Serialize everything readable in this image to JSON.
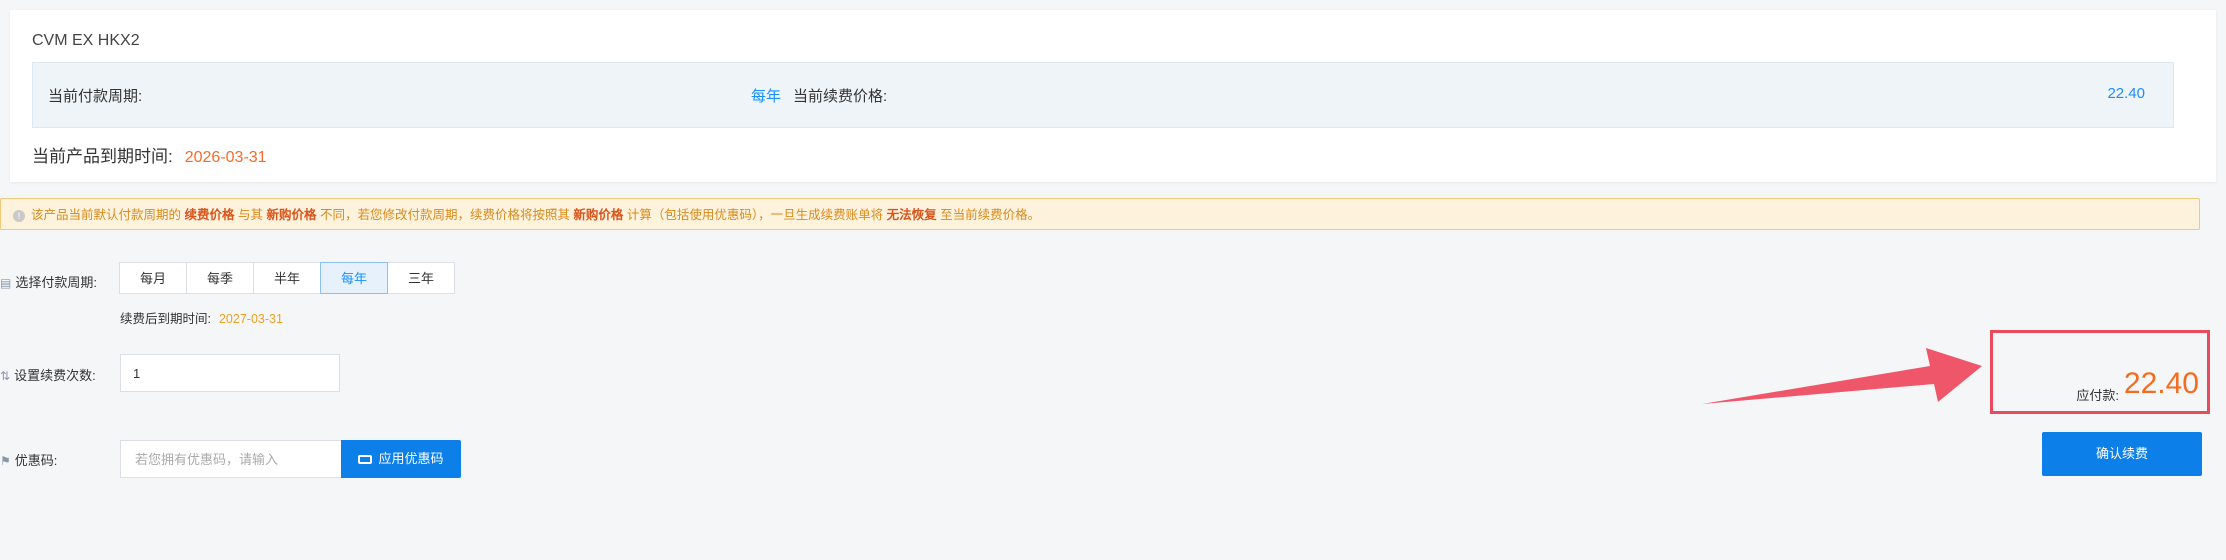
{
  "product": {
    "name": "CVM EX HKX2",
    "current_period_label": "当前付款周期:",
    "current_period_value": "每年",
    "current_price_label": "当前续费价格:",
    "current_price_value": "22.40",
    "expire_label": "当前产品到期时间:",
    "expire_value": "2026-03-31"
  },
  "notice": {
    "t1": "该产品当前默认付款周期的 ",
    "b1": "续费价格",
    "t2": " 与其 ",
    "b2": "新购价格",
    "t3": " 不同，若您修改付款周期，续费价格将按照其 ",
    "b3": "新购价格",
    "t4": " 计算（包括使用优惠码），一旦生成续费账单将 ",
    "b4": "无法恢复",
    "t5": " 至当前续费价格。"
  },
  "period": {
    "label": "选择付款周期:",
    "options": [
      "每月",
      "每季",
      "半年",
      "每年",
      "三年"
    ],
    "selected": "每年",
    "after_label": "续费后到期时间:",
    "after_value": "2027-03-31"
  },
  "renew_count": {
    "label": "设置续费次数:",
    "value": "1"
  },
  "coupon": {
    "label": "优惠码:",
    "placeholder": "若您拥有优惠码，请输入",
    "button": "应用优惠码"
  },
  "payment": {
    "label": "应付款:",
    "amount": "22.40",
    "confirm": "确认续费"
  },
  "colors": {
    "accent": "#0d7fe8",
    "price": "#f56c1f",
    "highlight_box": "#e94b5c",
    "arrow": "#f0566a"
  },
  "icons": [
    "info-icon",
    "calendar-icon",
    "sort-icon",
    "tag-icon",
    "ticket-icon",
    "arrow-annotation"
  ]
}
